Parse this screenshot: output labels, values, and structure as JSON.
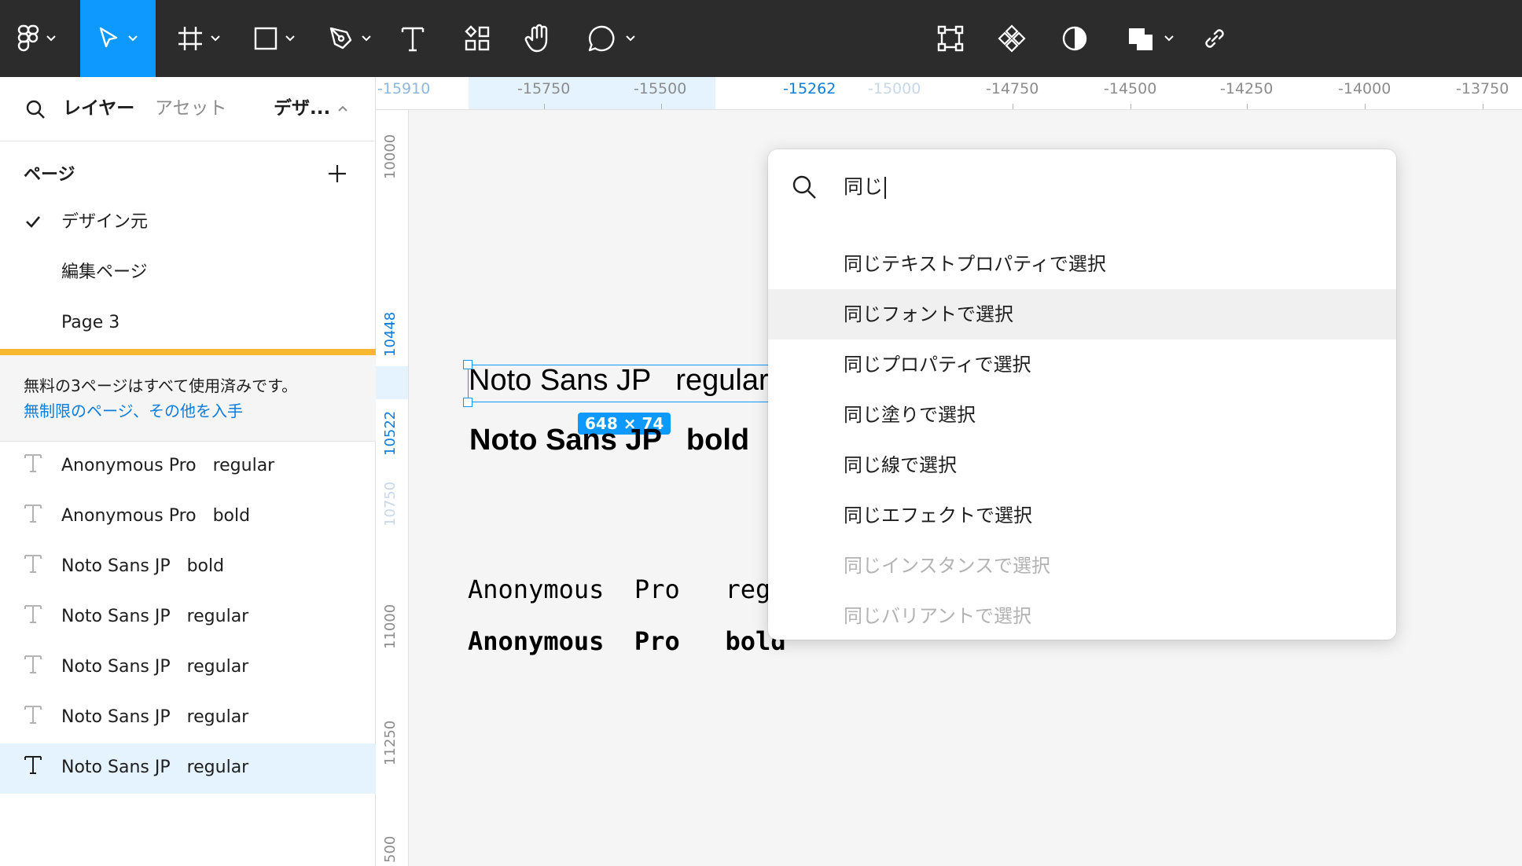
{
  "toolbar": {
    "tools": [
      {
        "name": "main-menu",
        "icon": "figma-logo-icon"
      },
      {
        "name": "move",
        "icon": "cursor-arrow-icon",
        "active": true
      },
      {
        "name": "frame",
        "icon": "frame-hash-icon"
      },
      {
        "name": "shape",
        "icon": "rectangle-icon"
      },
      {
        "name": "pen",
        "icon": "pen-tool-icon"
      },
      {
        "name": "text",
        "icon": "text-t-icon"
      },
      {
        "name": "resources",
        "icon": "components-grid-icon"
      },
      {
        "name": "hand",
        "icon": "hand-icon"
      },
      {
        "name": "comment",
        "icon": "comment-bubble-icon"
      },
      {
        "name": "edit-object",
        "icon": "edit-object-icon"
      },
      {
        "name": "create-component",
        "icon": "component-diamond-icon"
      },
      {
        "name": "mask",
        "icon": "mask-contrast-icon"
      },
      {
        "name": "boolean",
        "icon": "boolean-union-icon"
      },
      {
        "name": "link",
        "icon": "link-icon"
      }
    ],
    "accent": "#0d99ff"
  },
  "left_panel": {
    "tabs": {
      "layers": "レイヤー",
      "assets": "アセット",
      "design_source": "デザ..."
    },
    "pages_header": "ページ",
    "pages": [
      {
        "label": "デザイン元",
        "current": true
      },
      {
        "label": "編集ページ",
        "current": false
      },
      {
        "label": "Page 3",
        "current": false
      }
    ],
    "warning": {
      "text": "無料の3ページはすべて使用済みです。",
      "link": "無制限のページ、その他を入手",
      "color": "#f7b731"
    },
    "layers": [
      {
        "label": "Anonymous Pro   regular",
        "selected": false
      },
      {
        "label": "Anonymous Pro   bold",
        "selected": false
      },
      {
        "label": "Noto Sans JP   bold",
        "selected": false
      },
      {
        "label": "Noto Sans JP   regular",
        "selected": false
      },
      {
        "label": "Noto Sans JP   regular",
        "selected": false
      },
      {
        "label": "Noto Sans JP   regular",
        "selected": false
      },
      {
        "label": "Noto Sans JP   regular",
        "selected": true
      }
    ]
  },
  "rulers": {
    "horizontal": [
      "-15910",
      "-15750",
      "-15500",
      "-15262",
      "-15000",
      "-14750",
      "-14500",
      "-14250",
      "-14000",
      "-13750"
    ],
    "vertical": [
      "10000",
      "10448",
      "10522",
      "10750",
      "11000",
      "11250",
      "500"
    ]
  },
  "canvas": {
    "texts": {
      "noto_regular": "Noto Sans JP   regular",
      "noto_bold": "Noto Sans JP   bold",
      "anon_regular": "Anonymous  Pro   regu",
      "anon_bold": "Anonymous  Pro   bold"
    },
    "selection_size": "648 × 74"
  },
  "command_palette": {
    "query": "同じ",
    "options": [
      {
        "label": "同じテキストプロパティで選択",
        "enabled": true,
        "hover": false
      },
      {
        "label": "同じフォントで選択",
        "enabled": true,
        "hover": true
      },
      {
        "label": "同じプロパティで選択",
        "enabled": true,
        "hover": false
      },
      {
        "label": "同じ塗りで選択",
        "enabled": true,
        "hover": false
      },
      {
        "label": "同じ線で選択",
        "enabled": true,
        "hover": false
      },
      {
        "label": "同じエフェクトで選択",
        "enabled": true,
        "hover": false
      },
      {
        "label": "同じインスタンスで選択",
        "enabled": false,
        "hover": false
      },
      {
        "label": "同じバリアントで選択",
        "enabled": false,
        "hover": false
      }
    ]
  }
}
